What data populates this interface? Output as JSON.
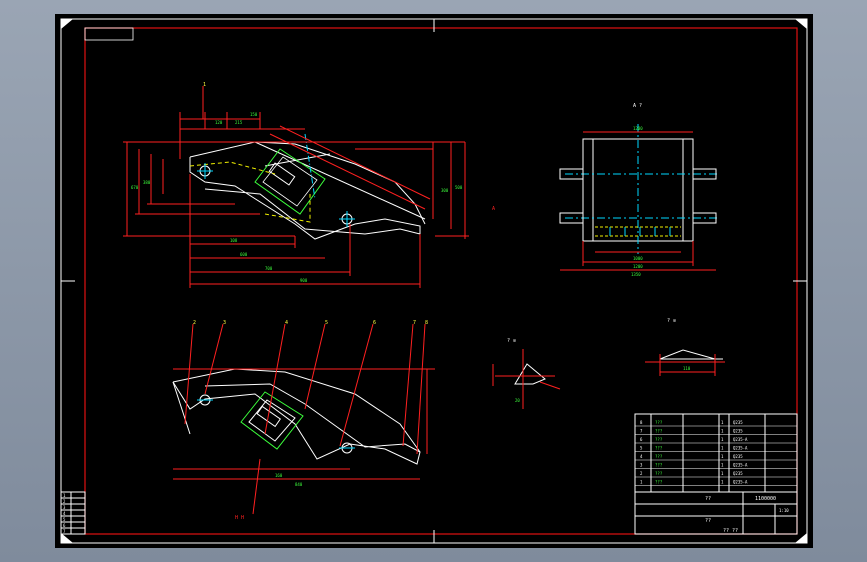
{
  "drawing": {
    "view_label_top_right": "A ?",
    "view_label_mid_right": "? ⊙",
    "view_label_small": "? ⊙",
    "part_numbers_top": [
      "1"
    ],
    "part_numbers_bottom": [
      "2",
      "3",
      "4",
      "5",
      "6",
      "7",
      "8"
    ],
    "dims_top": [
      "120",
      "215",
      "150",
      "1000",
      "108",
      "600",
      "700",
      "900",
      "155",
      "100",
      "80",
      "80"
    ],
    "dims_right": [
      "500",
      "300",
      "670",
      "380",
      "1200",
      "1350"
    ],
    "dims_bottom_view": [
      "160",
      "840"
    ],
    "dim_small_a": "110",
    "dim_small_b": "20",
    "label_bottom_left": "H H",
    "label_section": "? ⊙"
  },
  "title_block": {
    "drawing_number": "1100000",
    "scale": "1:10",
    "sheet_label": "??",
    "name_label": "??",
    "footer_label": "?? ??",
    "rows": [
      {
        "n": "8",
        "name": "???",
        "qty": "1",
        "mat": "Q235"
      },
      {
        "n": "7",
        "name": "???",
        "qty": "1",
        "mat": "Q235"
      },
      {
        "n": "6",
        "name": "???",
        "qty": "1",
        "mat": "Q235-A"
      },
      {
        "n": "5",
        "name": "???",
        "qty": "1",
        "mat": "Q235-A"
      },
      {
        "n": "4",
        "name": "???",
        "qty": "1",
        "mat": "Q235"
      },
      {
        "n": "3",
        "name": "???",
        "qty": "1",
        "mat": "Q235-A"
      },
      {
        "n": "2",
        "name": "???",
        "qty": "1",
        "mat": "Q235"
      },
      {
        "n": "1",
        "name": "???",
        "qty": "1",
        "mat": "Q235-A"
      }
    ]
  },
  "revision_block": [
    "1",
    "2",
    "3",
    "4",
    "5",
    "6",
    "7"
  ],
  "colors": {
    "frame": "#ffffff",
    "border": "#e01010",
    "outline": "#ffffff",
    "dims": "#ff2020",
    "centerline": "#00d8ff",
    "hidden": "#f0f000",
    "text_green": "#3cff3c",
    "text_yellow": "#ffff40"
  }
}
